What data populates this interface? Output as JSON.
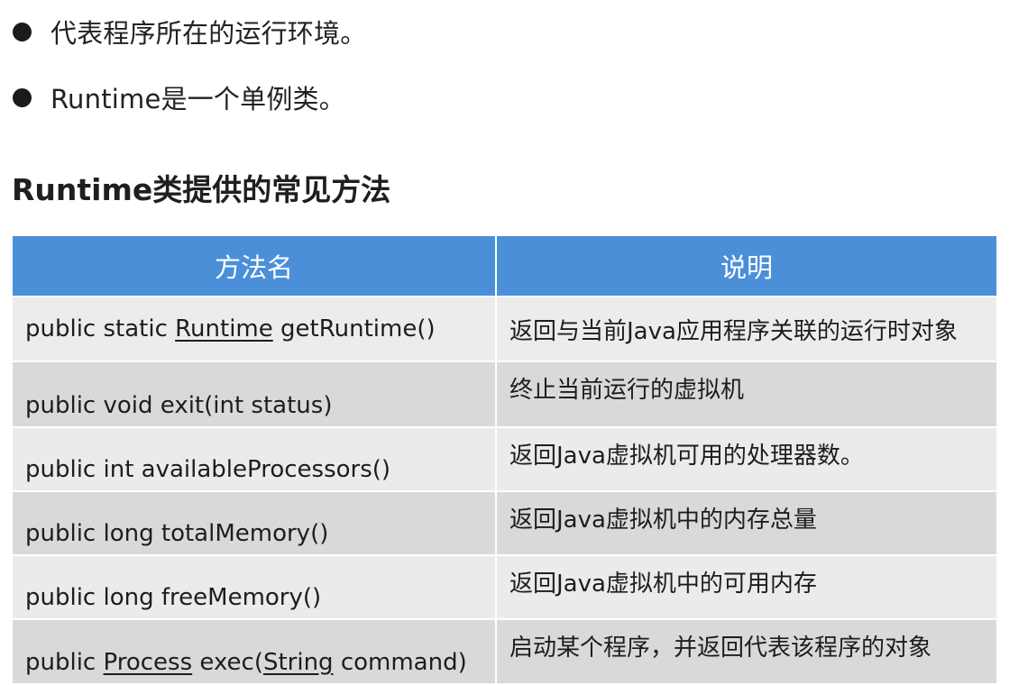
{
  "bullets": [
    {
      "text": "代表程序所在的运行环境。"
    },
    {
      "text": "Runtime是一个单例类。"
    }
  ],
  "section_title": "Runtime类提供的常见方法",
  "table": {
    "headers": [
      "方法名",
      "说明"
    ],
    "rows": [
      {
        "method": {
          "pre": "public static ",
          "link": "Runtime",
          "post": " getRuntime()"
        },
        "desc": "返回与当前Java应用程序关联的运行时对象"
      },
      {
        "method": {
          "pre": "public void exit(int status)"
        },
        "desc": "终止当前运行的虚拟机"
      },
      {
        "method": {
          "pre": "public int availableProcessors()"
        },
        "desc": "返回Java虚拟机可用的处理器数。"
      },
      {
        "method": {
          "pre": "public long totalMemory()"
        },
        "desc": "返回Java虚拟机中的内存总量"
      },
      {
        "method": {
          "pre": "public long freeMemory()"
        },
        "desc": "返回Java虚拟机中的可用内存"
      },
      {
        "method": {
          "pre": "public ",
          "link": "Process",
          "mid": " exec(",
          "link2": "String",
          "post": " command)"
        },
        "desc": "启动某个程序，并返回代表该程序的对象"
      }
    ]
  },
  "colors": {
    "header_bg": "#4a8fd8",
    "row_light": "#ececec",
    "row_dark": "#d9d9d9"
  }
}
